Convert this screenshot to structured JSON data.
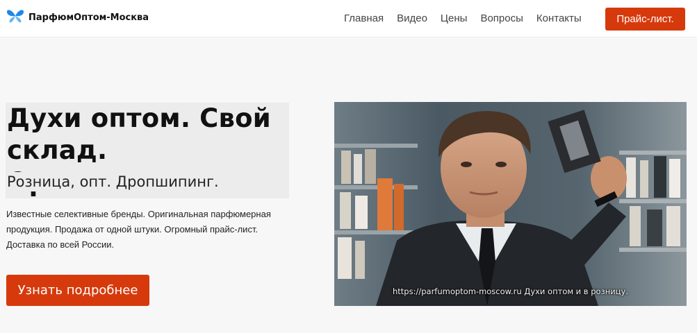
{
  "brand": {
    "name": "ПарфюмОптом-Москва",
    "icon": "butterfly-icon",
    "color": "#1e88e5"
  },
  "nav": {
    "items": [
      "Главная",
      "Видео",
      "Цены",
      "Вопросы",
      "Контакты"
    ],
    "price_button": "Прайс-лист."
  },
  "hero": {
    "title": "Духи оптом. Свой склад. Оригиналы.",
    "subtitle": "Розница, опт. Дропшипинг.",
    "description": "Известные селективные бренды. Оригинальная парфюмерная продукция. Продажа от одной штуки. Огромный прайс-лист. Доставка по всей России.",
    "cta": "Узнать подробнее"
  },
  "video": {
    "caption": "https://parfumoptom-moscow.ru  Духи оптом и в розницу."
  },
  "colors": {
    "accent": "#d63a0c",
    "background": "#f7f7f7"
  }
}
